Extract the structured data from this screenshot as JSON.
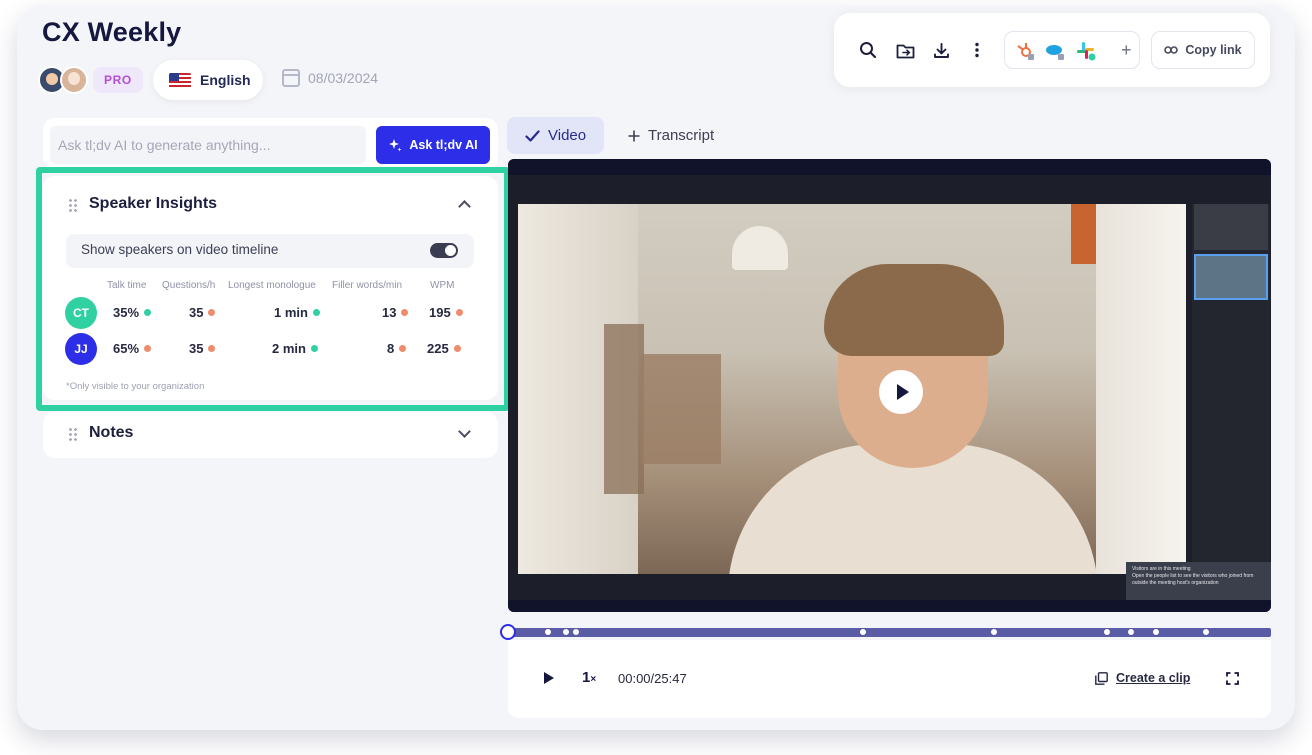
{
  "meeting": {
    "title": "CX Weekly",
    "plan_badge": "PRO",
    "language": "English",
    "date": "08/03/2024"
  },
  "toolbar": {
    "integration_plus": "+",
    "copy_link_label": "Copy link"
  },
  "ai": {
    "placeholder": "Ask tl;dv AI to generate anything...",
    "button_label": "Ask tl;dv AI"
  },
  "speaker_insights": {
    "title": "Speaker Insights",
    "show_on_timeline_label": "Show speakers on video timeline",
    "show_on_timeline_enabled": true,
    "columns": [
      "Talk time",
      "Questions/h",
      "Longest monologue",
      "Filler words/min",
      "WPM"
    ],
    "speakers": [
      {
        "initials": "CT",
        "color": "#2fd0a2",
        "talk_time": "35%",
        "questions": "35",
        "monologue": "1 min",
        "filler": "13",
        "wpm": "195"
      },
      {
        "initials": "JJ",
        "color": "#2c2ee8",
        "talk_time": "65%",
        "questions": "35",
        "monologue": "2 min",
        "filler": "8",
        "wpm": "225"
      }
    ],
    "footnote": "*Only visible to your organization"
  },
  "notes": {
    "title": "Notes"
  },
  "tabs": {
    "video": "Video",
    "transcript": "Transcript"
  },
  "video_overlay": {
    "visitors_title": "Visitors are in this meeting",
    "visitors_text": "Open the people list to see the visitors who joined from outside the meeting host's organization"
  },
  "player": {
    "speed_value": "1",
    "speed_unit": "×",
    "time": "00:00/25:47",
    "create_clip_label": "Create a clip",
    "progress_fraction": 0
  },
  "colors": {
    "accent": "#2c2ee8",
    "highlight": "#2fd0a2",
    "positive_dot": "#2fd0a2",
    "negative_dot": "#f08b6d"
  }
}
